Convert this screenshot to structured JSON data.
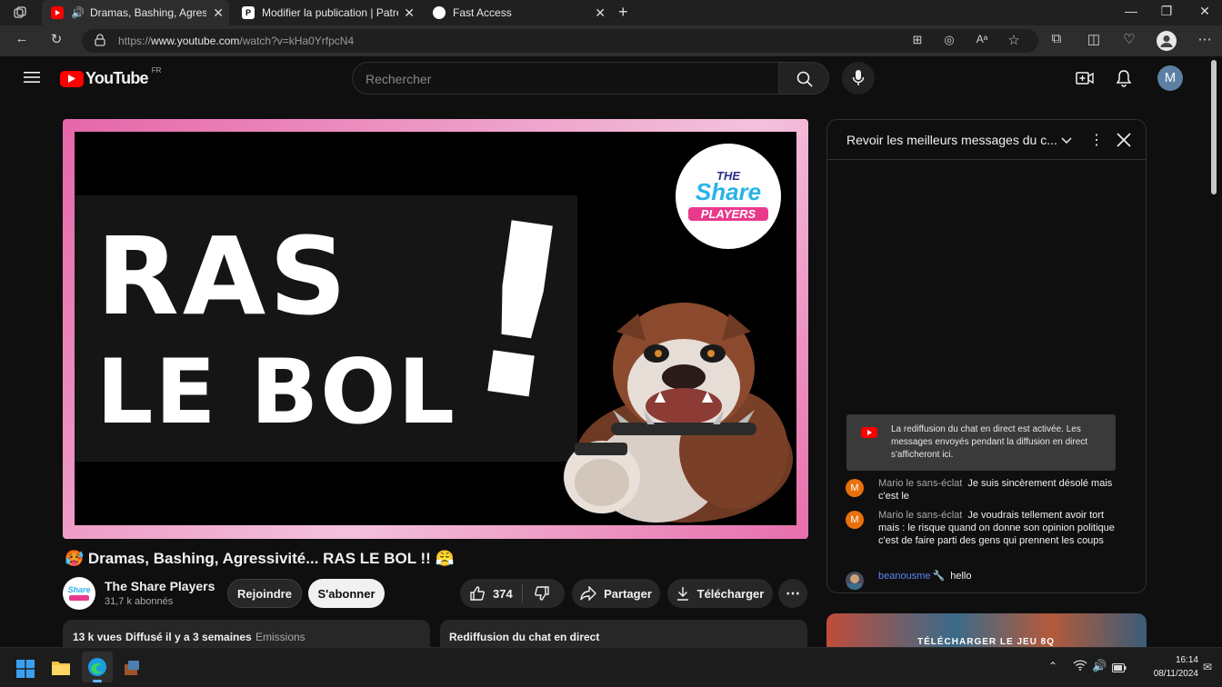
{
  "browser": {
    "tabs": [
      {
        "label": "Dramas, Bashing, Agressivité",
        "active": true
      },
      {
        "label": "Modifier la publication | Patreon",
        "active": false
      },
      {
        "label": "Fast Access",
        "active": false
      }
    ],
    "url_prefix": "https://",
    "url_host": "www.youtube.com",
    "url_path": "/watch?v=kHa0YrfpcN4"
  },
  "youtube": {
    "logo_text": "YouTube",
    "country": "FR",
    "search_placeholder": "Rechercher",
    "avatar_letter": "M"
  },
  "video": {
    "title": "🥵 Dramas, Bashing, Agressivité... RAS LE BOL !! 😤",
    "thumbnail_line1": "RAS",
    "thumbnail_line2": "LE BOL",
    "thumbnail_mark": "!",
    "logo_line1": "THE",
    "logo_line2": "Share",
    "logo_line3": "PLAYERS",
    "channel_name": "The Share Players",
    "subscribers": "31,7 k abonnés",
    "join_label": "Rejoindre",
    "subscribe_label": "S'abonner",
    "likes": "374",
    "share_label": "Partager",
    "download_label": "Télécharger",
    "views": "13 k vues",
    "posted": "Diffusé il y a 3 semaines",
    "category": "Emissions",
    "chat_replay_label": "Rediffusion du chat en direct"
  },
  "chat": {
    "header": "Revoir les meilleurs messages du c...",
    "notice": "La rediffusion du chat en direct est activée. Les messages envoyés pendant la diffusion en direct s'afficheront ici.",
    "messages": [
      {
        "author": "Mario le sans-éclat",
        "text": "Je suis sincèrement désolé mais c'est le",
        "avatar": "M"
      },
      {
        "author": "Mario le sans-éclat",
        "text": "Je voudrais tellement avoir tort mais : le risque quand on donne son opinion politique c'est de faire parti des gens qui prennent les coups",
        "avatar": "M"
      },
      {
        "author": "beanousme",
        "text": "hello",
        "avatar": ""
      }
    ],
    "next_thumb_text": "TÉLÉCHARGER LE JEU 8Q"
  },
  "taskbar": {
    "time": "16:14",
    "date": "08/11/2024"
  },
  "colors": {
    "youtube_red": "#ff0000",
    "avatar_blue": "#5c7fa3",
    "chat_avatar": "#e8710a",
    "mod_blue": "#5e84f1"
  }
}
